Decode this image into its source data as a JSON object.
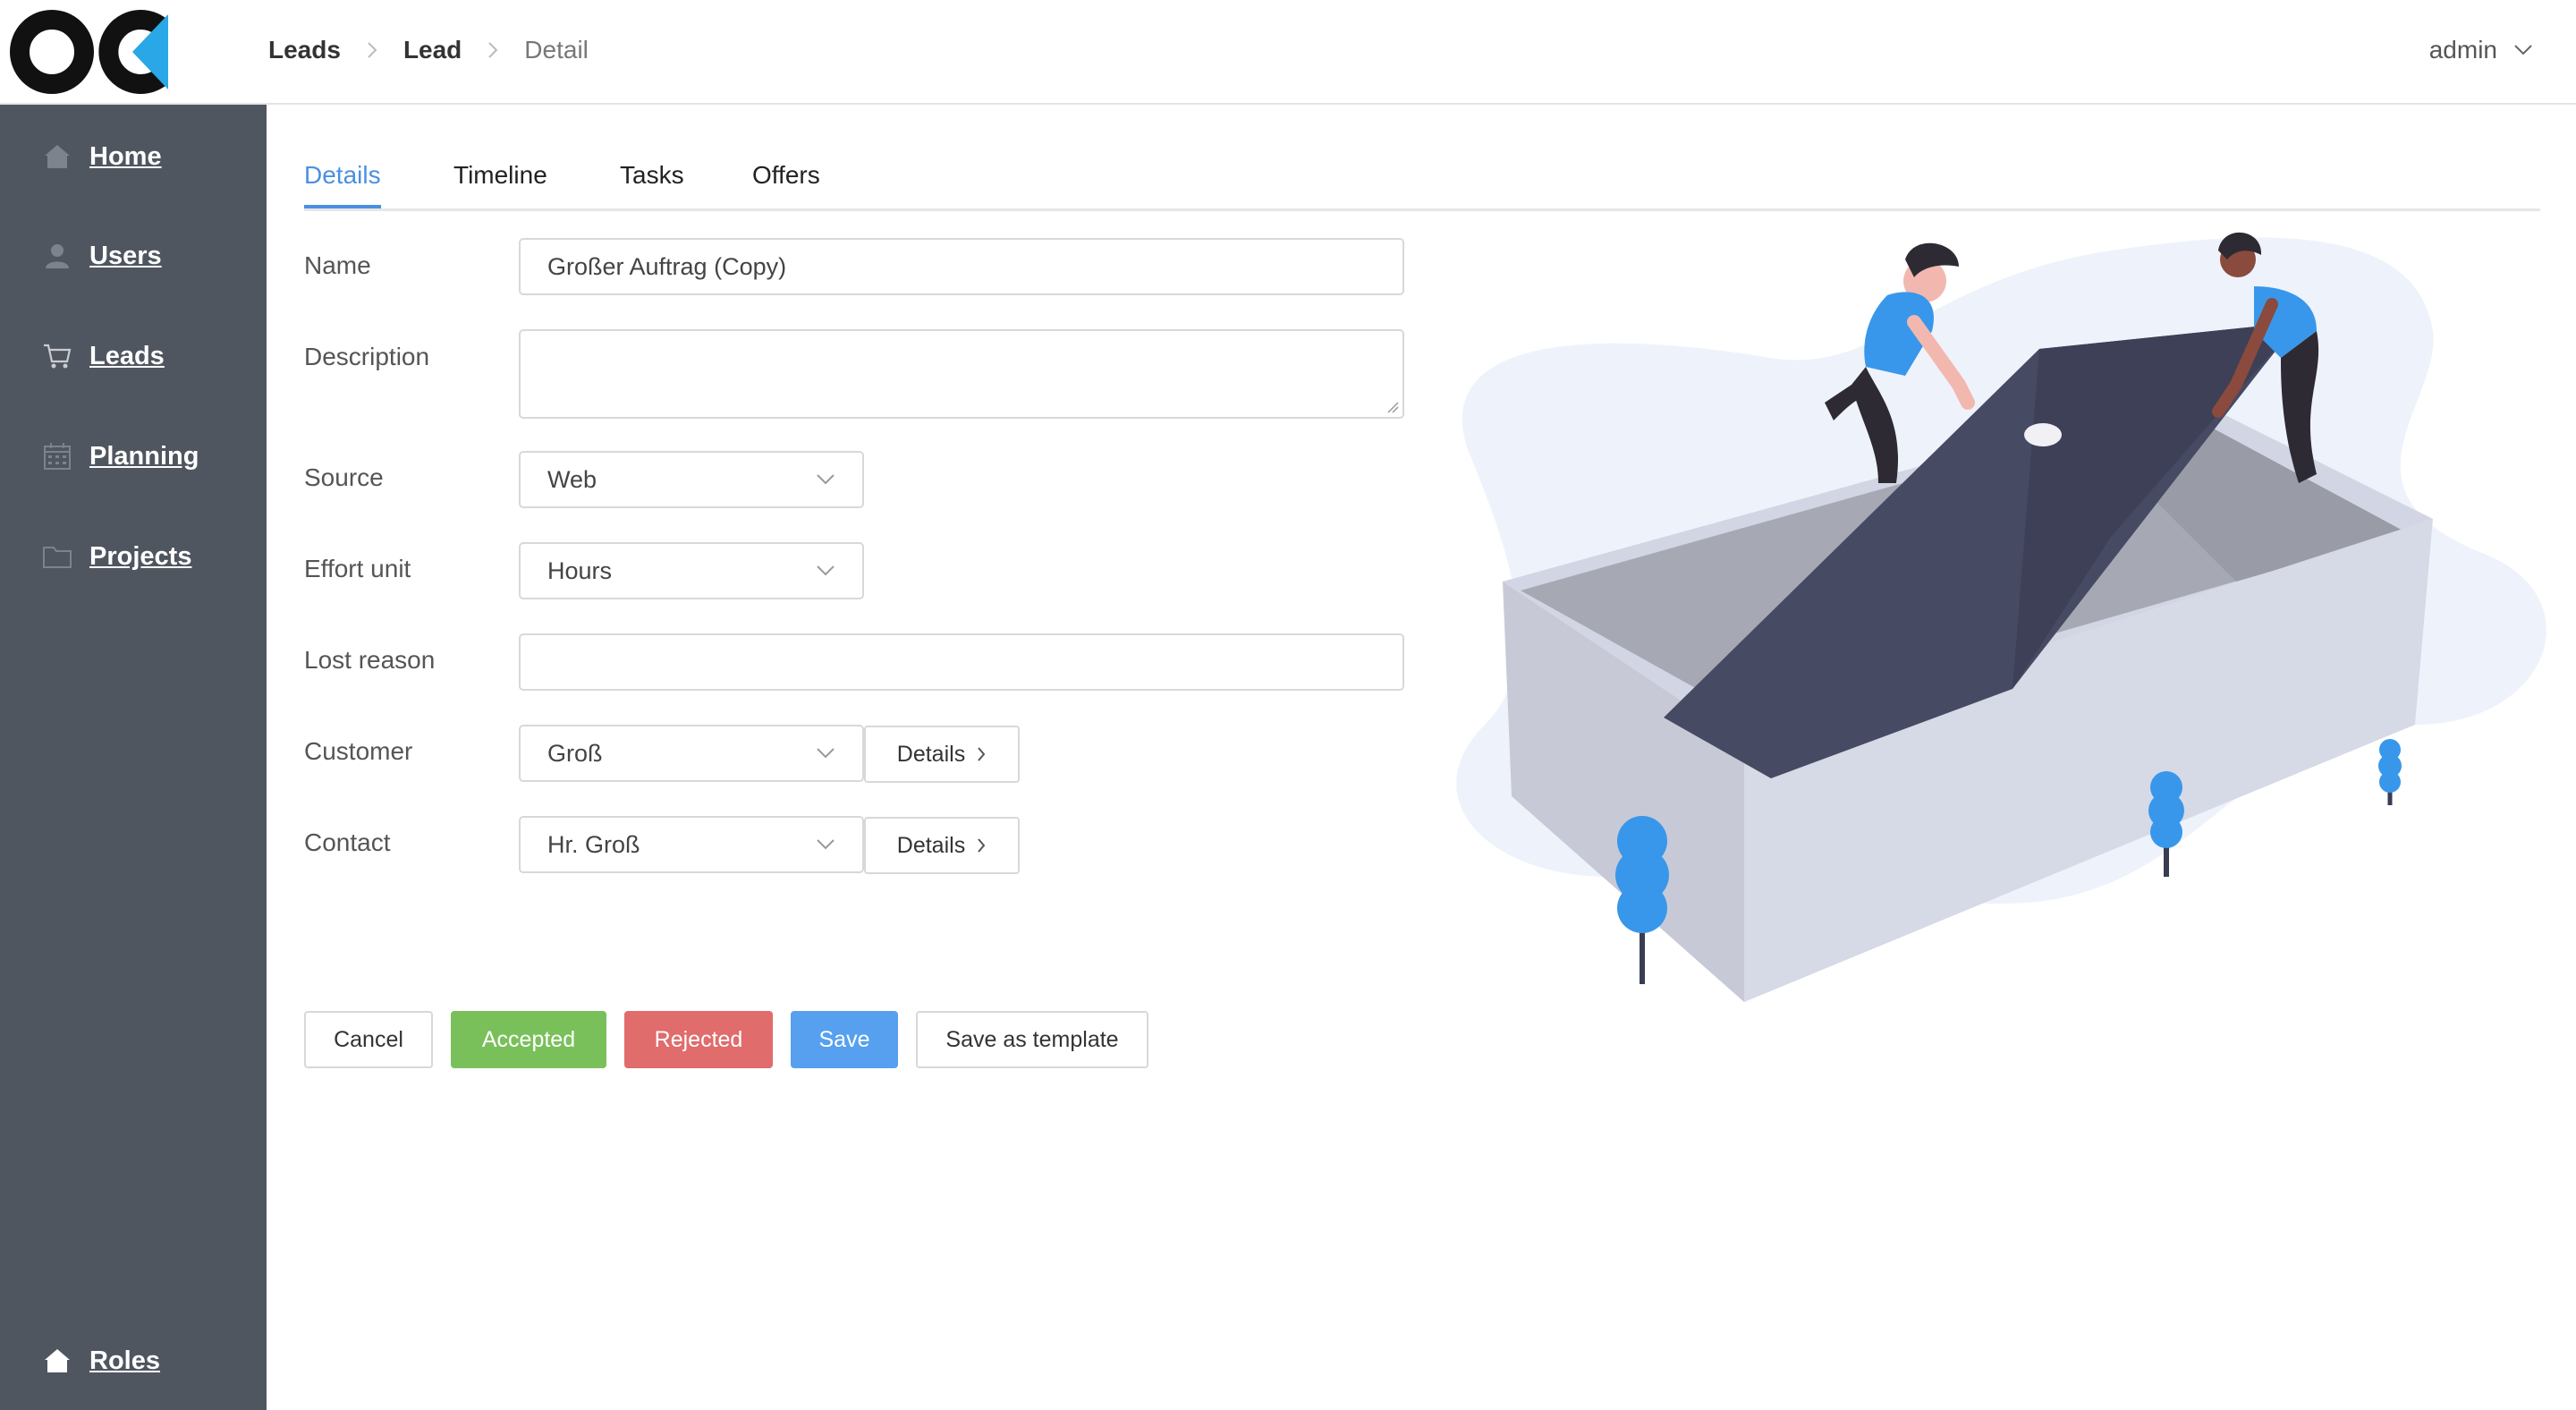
{
  "header": {
    "breadcrumb": [
      "Leads",
      "Lead",
      "Detail"
    ],
    "user": "admin"
  },
  "sidebar": {
    "items": [
      {
        "label": "Home",
        "icon": "home-icon"
      },
      {
        "label": "Users",
        "icon": "user-icon"
      },
      {
        "label": "Leads",
        "icon": "cart-icon"
      },
      {
        "label": "Planning",
        "icon": "calendar-icon"
      },
      {
        "label": "Projects",
        "icon": "folder-icon"
      }
    ],
    "bottom_item": {
      "label": "Roles",
      "icon": "home-icon"
    }
  },
  "tabs": [
    "Details",
    "Timeline",
    "Tasks",
    "Offers"
  ],
  "active_tab": "Details",
  "form": {
    "name": {
      "label": "Name",
      "value": "Großer Auftrag (Copy)"
    },
    "description": {
      "label": "Description",
      "value": ""
    },
    "source": {
      "label": "Source",
      "value": "Web"
    },
    "effort_unit": {
      "label": "Effort unit",
      "value": "Hours"
    },
    "lost_reason": {
      "label": "Lost reason",
      "value": ""
    },
    "customer": {
      "label": "Customer",
      "value": "Groß",
      "details_label": "Details"
    },
    "contact": {
      "label": "Contact",
      "value": "Hr. Groß",
      "details_label": "Details"
    }
  },
  "actions": {
    "cancel": "Cancel",
    "accepted": "Accepted",
    "rejected": "Rejected",
    "save": "Save",
    "save_template": "Save as template"
  },
  "colors": {
    "sidebar_bg": "#505660",
    "accent": "#4a90e2",
    "success": "#7ac05a",
    "danger": "#e06c6c",
    "primary": "#56a0ef"
  }
}
